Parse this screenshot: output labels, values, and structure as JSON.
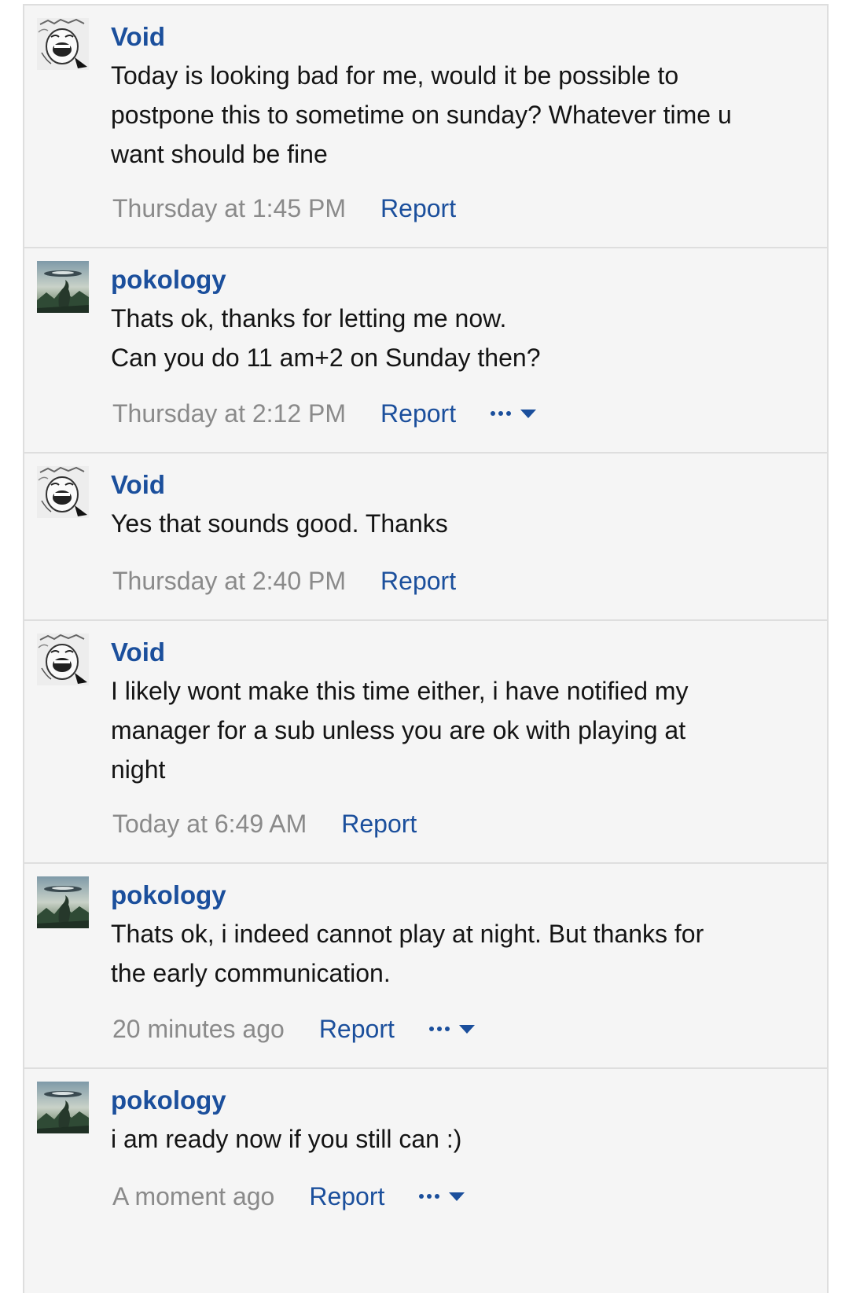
{
  "messages": [
    {
      "author": "Void",
      "avatar": "manga-face-icon",
      "lines": [
        "Today is looking bad for me, would it be possible to",
        "postpone this to sometime on sunday? Whatever time u",
        "want should be fine"
      ],
      "time": "Thursday at 1:45 PM",
      "report_label": "Report",
      "has_more_menu": false
    },
    {
      "author": "pokology",
      "avatar": "landscape-creature-icon",
      "lines": [
        "Thats ok, thanks for letting me now.",
        "Can you do 11 am+2 on Sunday then?"
      ],
      "time": "Thursday at 2:12 PM",
      "report_label": "Report",
      "has_more_menu": true
    },
    {
      "author": "Void",
      "avatar": "manga-face-icon",
      "lines": [
        "Yes that sounds good. Thanks"
      ],
      "time": "Thursday at 2:40 PM",
      "report_label": "Report",
      "has_more_menu": false
    },
    {
      "author": "Void",
      "avatar": "manga-face-icon",
      "lines": [
        "I likely wont make this time either, i have notified my",
        "manager for a sub unless you are ok with playing at",
        "night"
      ],
      "time": "Today at 6:49 AM",
      "report_label": "Report",
      "has_more_menu": false
    },
    {
      "author": "pokology",
      "avatar": "landscape-creature-icon",
      "lines": [
        "Thats ok, i indeed cannot play at night. But thanks for",
        "the early communication."
      ],
      "time": "20 minutes ago",
      "report_label": "Report",
      "has_more_menu": true
    },
    {
      "author": "pokology",
      "avatar": "landscape-creature-icon",
      "lines": [
        "i am ready now if you still can :)"
      ],
      "time": "A moment ago",
      "report_label": "Report",
      "has_more_menu": true
    }
  ],
  "colors": {
    "link": "#1b4f9c",
    "text": "#141414",
    "muted": "#8a8a8a",
    "background": "#f5f5f5",
    "divider": "#dedede"
  }
}
